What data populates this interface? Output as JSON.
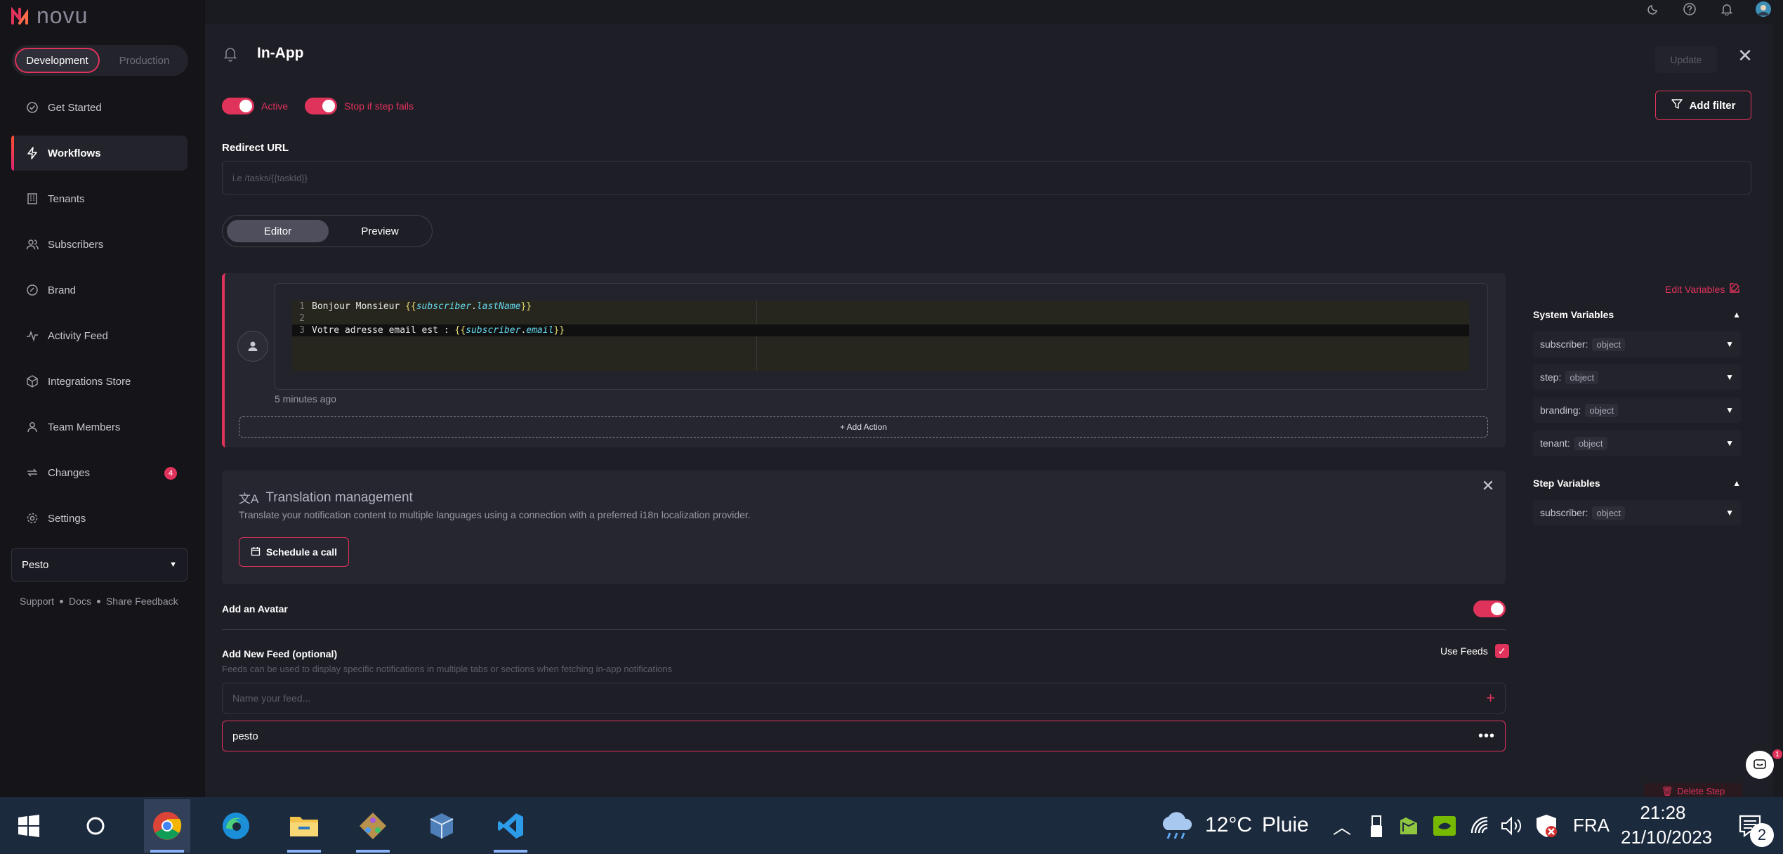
{
  "app": {
    "logo": "novu"
  },
  "env": {
    "development": "Development",
    "production": "Production"
  },
  "nav": [
    {
      "label": "Get Started",
      "icon": "check-circle-icon"
    },
    {
      "label": "Workflows",
      "icon": "bolt-icon"
    },
    {
      "label": "Tenants",
      "icon": "building-icon"
    },
    {
      "label": "Subscribers",
      "icon": "users-icon"
    },
    {
      "label": "Brand",
      "icon": "palette-icon"
    },
    {
      "label": "Activity Feed",
      "icon": "activity-icon"
    },
    {
      "label": "Integrations Store",
      "icon": "box-icon"
    },
    {
      "label": "Team Members",
      "icon": "team-icon"
    },
    {
      "label": "Changes",
      "icon": "swap-icon",
      "badge": "4"
    },
    {
      "label": "Settings",
      "icon": "gear-icon"
    }
  ],
  "org": {
    "name": "Pesto"
  },
  "footer": {
    "support": "Support",
    "docs": "Docs",
    "feedback": "Share Feedback"
  },
  "step": {
    "title": "In-App",
    "update_label": "Update",
    "active_label": "Active",
    "stop_label": "Stop if step fails",
    "add_filter_label": "Add filter",
    "redirect_label": "Redirect URL",
    "redirect_placeholder": "i.e /tasks/{{taskId}}",
    "tab_editor": "Editor",
    "tab_preview": "Preview"
  },
  "editor": {
    "lines": [
      {
        "n": "1",
        "prefix": "Bonjour Monsieur ",
        "open": "{{",
        "var": "subscriber",
        "dot": ".",
        "field": "lastName",
        "close": "}}"
      },
      {
        "n": "2"
      },
      {
        "n": "3",
        "prefix": "Votre adresse email est : ",
        "open": "{{",
        "var": "subscriber",
        "dot": ".",
        "field": "email",
        "close": "}}"
      }
    ],
    "timestamp": "5 minutes ago",
    "add_action": "+ Add Action"
  },
  "translation": {
    "title": "Translation management",
    "description": "Translate your notification content to multiple languages using a connection with a preferred i18n localization provider.",
    "button": "Schedule a call"
  },
  "avatar": {
    "label": "Add an Avatar",
    "enabled": true
  },
  "feed": {
    "title": "Add New Feed (optional)",
    "description": "Feeds can be used to display specific notifications in multiple tabs or sections when fetching in-app notifications",
    "use_feeds_label": "Use Feeds",
    "use_feeds_checked": true,
    "placeholder": "Name your feed...",
    "items": [
      "pesto"
    ]
  },
  "variables": {
    "edit_label": "Edit Variables",
    "system_title": "System Variables",
    "system": [
      {
        "name": "subscriber:",
        "type": "object"
      },
      {
        "name": "step:",
        "type": "object"
      },
      {
        "name": "branding:",
        "type": "object"
      },
      {
        "name": "tenant:",
        "type": "object"
      }
    ],
    "step_title": "Step Variables",
    "step": [
      {
        "name": "subscriber:",
        "type": "object"
      }
    ]
  },
  "delete_label": "Delete Step",
  "chat_badge": "1",
  "taskbar": {
    "weather_temp": "12°C",
    "weather_desc": "Pluie",
    "lang": "FRA",
    "time": "21:28",
    "date": "21/10/2023",
    "notif_count": "2"
  },
  "colors": {
    "accent": "#e0335b",
    "bg": "#1e1e26",
    "sidebar": "#141419"
  }
}
